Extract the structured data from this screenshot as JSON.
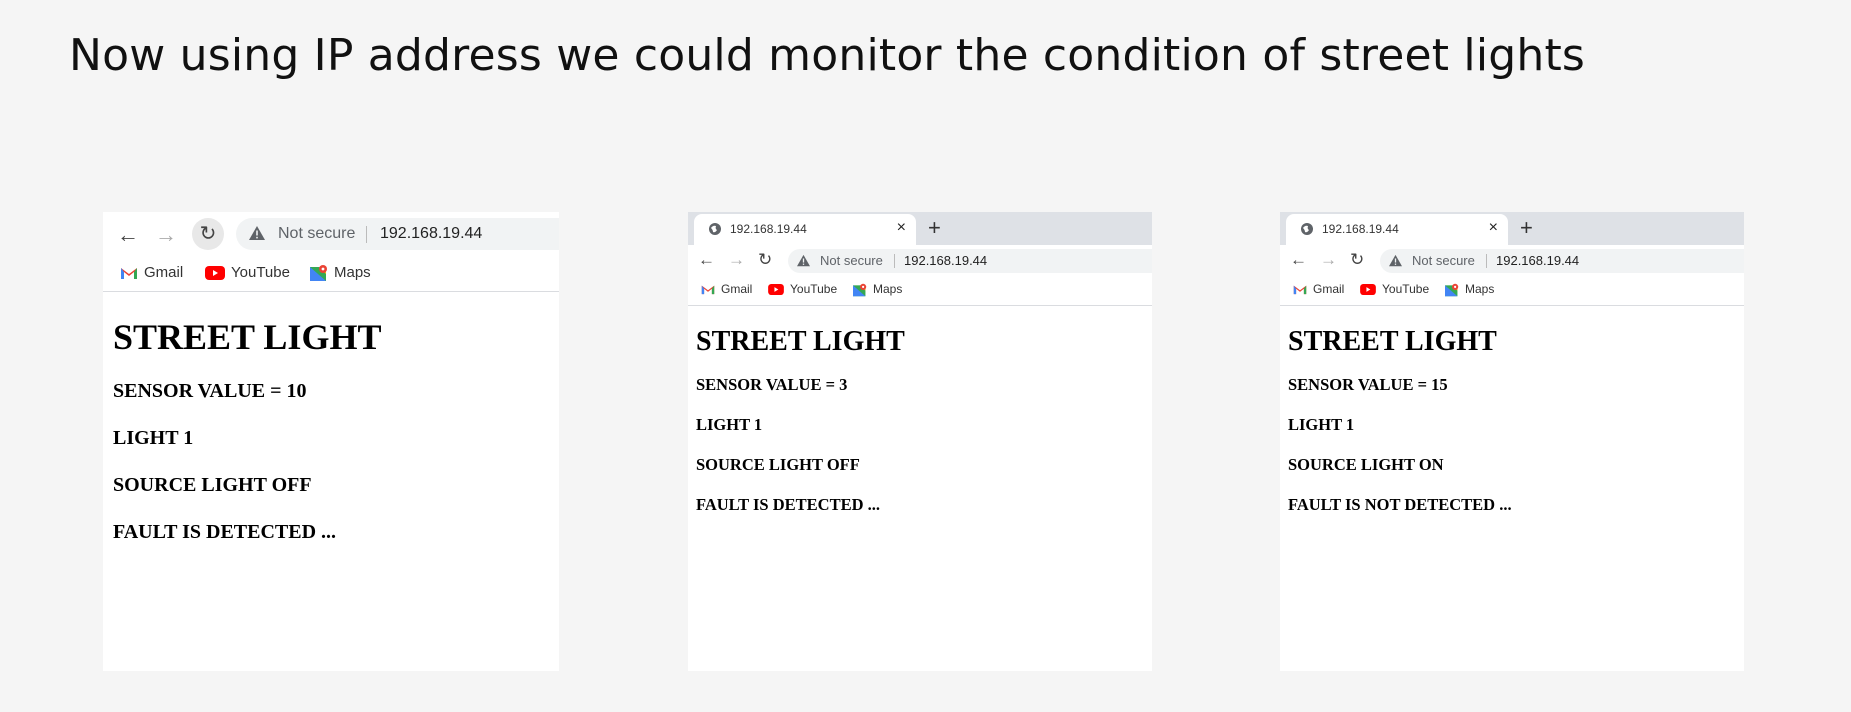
{
  "slide": {
    "title": "Now using IP address we could monitor the condition of street lights"
  },
  "shots": [
    {
      "url": "192.168.19.44",
      "not_secure": "Not secure",
      "bookmarks": [
        "Gmail",
        "YouTube",
        "Maps"
      ],
      "heading": "STREET LIGHT",
      "lines": [
        "SENSOR VALUE = 10",
        "LIGHT 1",
        "SOURCE LIGHT OFF",
        "FAULT IS DETECTED ..."
      ]
    },
    {
      "tab_title": "192.168.19.44",
      "tab_close": "×",
      "new_tab": "+",
      "url": "192.168.19.44",
      "not_secure": "Not secure",
      "bookmarks": [
        "Gmail",
        "YouTube",
        "Maps"
      ],
      "heading": "STREET LIGHT",
      "lines": [
        "SENSOR VALUE = 3",
        "LIGHT 1",
        "SOURCE LIGHT OFF",
        "FAULT IS DETECTED ..."
      ]
    },
    {
      "tab_title": "192.168.19.44",
      "tab_close": "×",
      "new_tab": "+",
      "url": "192.168.19.44",
      "not_secure": "Not secure",
      "bookmarks": [
        "Gmail",
        "YouTube",
        "Maps"
      ],
      "heading": "STREET LIGHT",
      "lines": [
        "SENSOR VALUE = 15",
        "LIGHT 1",
        "SOURCE LIGHT ON",
        "FAULT IS NOT DETECTED ..."
      ]
    }
  ],
  "icons": {
    "back": "arrow-left-icon",
    "forward": "arrow-right-icon",
    "reload": "reload-icon",
    "warning": "warning-triangle-icon",
    "gmail": "gmail-icon",
    "youtube": "youtube-icon",
    "maps": "maps-icon",
    "globe": "globe-icon"
  },
  "colors": {
    "background": "#f5f5f5",
    "youtube_red": "#ff0000",
    "gmail_red": "#ea4335",
    "tab_strip": "#dee1e6"
  }
}
